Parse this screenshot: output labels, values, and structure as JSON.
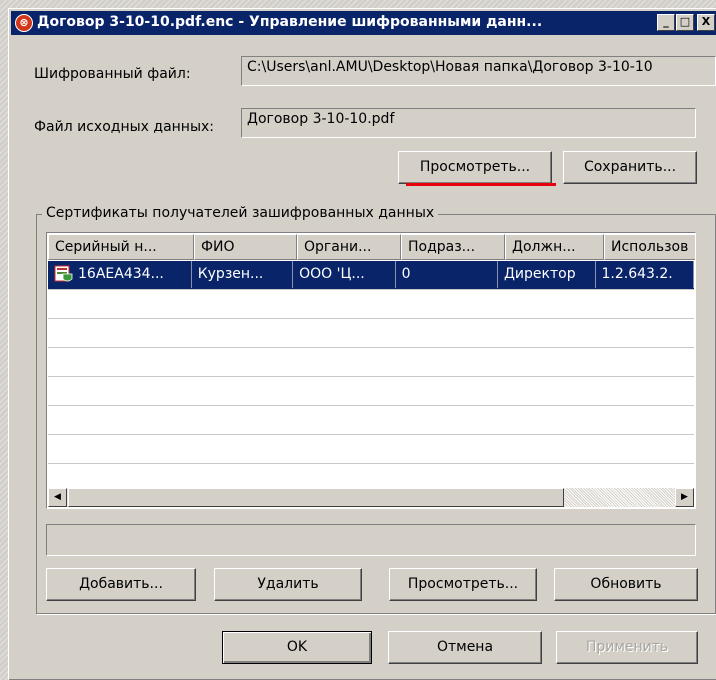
{
  "window": {
    "title": "Договор 3-10-10.pdf.enc - Управление шифрованными данн...",
    "icon": "shield-lock-icon",
    "controls": {
      "minimize": "_",
      "maximize": "□",
      "close": "X"
    }
  },
  "form": {
    "encrypted_file_label": "Шифрованный файл:",
    "encrypted_file_value": "C:\\Users\\anl.AMU\\Desktop\\Новая папка\\Договор 3-10-10",
    "source_file_label": "Файл исходных данных:",
    "source_file_value": "Договор 3-10-10.pdf",
    "view_button": "Просмотреть...",
    "save_button": "Сохранить..."
  },
  "certificates": {
    "group_title": "Сертификаты получателей зашифрованных данных",
    "columns": [
      "Серийный н...",
      "ФИО",
      "Органи...",
      "Подраз...",
      "Должн...",
      "Использов"
    ],
    "rows": [
      {
        "serial": "16AEA434...",
        "name": "Курзен...",
        "org": "ООО 'Ц...",
        "dept": "0",
        "position": "Директор",
        "usage": "1.2.643.2."
      }
    ],
    "buttons": {
      "add": "Добавить...",
      "remove": "Удалить",
      "view": "Просмотреть...",
      "refresh": "Обновить"
    }
  },
  "dialog_buttons": {
    "ok": "OK",
    "cancel": "Отмена",
    "apply": "Применить"
  },
  "colors": {
    "selection": "#0a246a",
    "highlight_mark": "#e8000a",
    "titlebar": "#0a246a"
  }
}
